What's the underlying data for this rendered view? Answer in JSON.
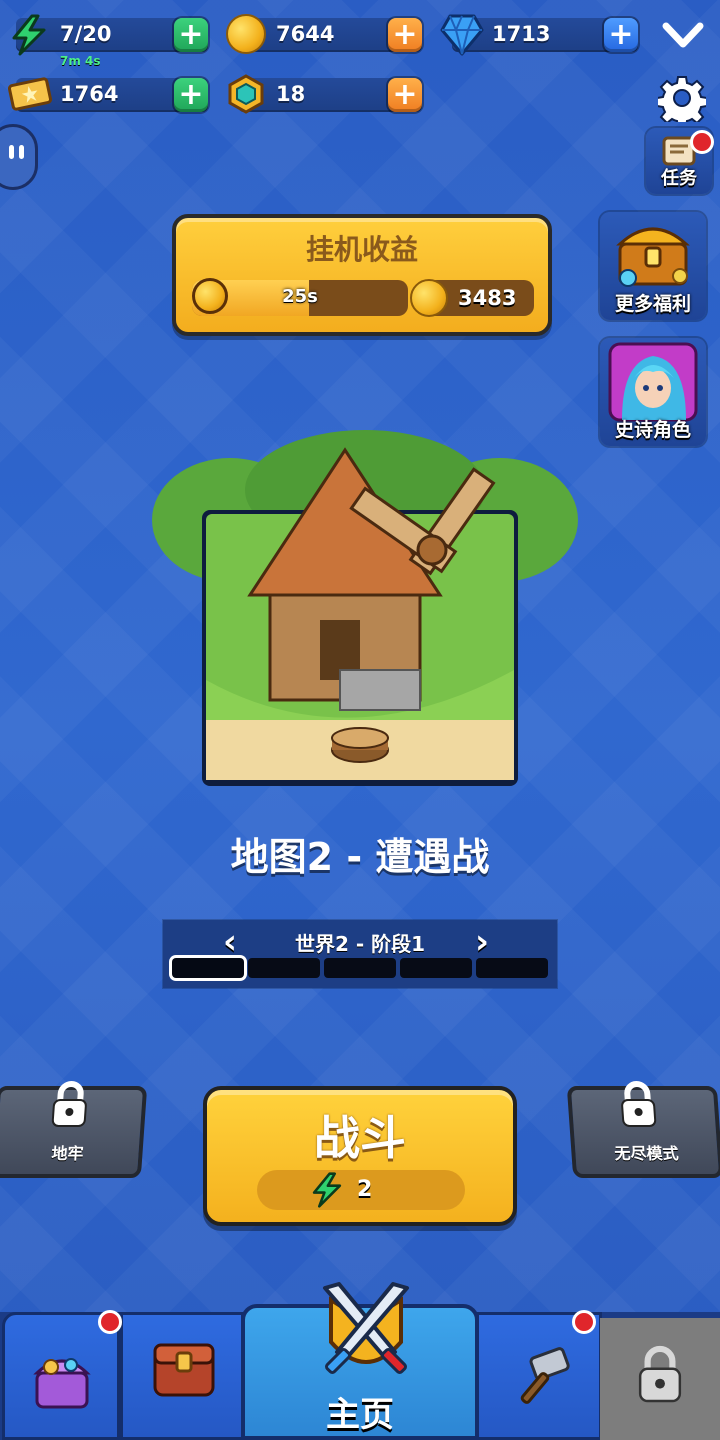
{
  "resources": {
    "energy": {
      "value": "7/20",
      "timer": "7m 4s",
      "icon": "lightning-icon",
      "color": "#2fd16e"
    },
    "gold": {
      "value": "7644",
      "icon": "gold-coin-icon"
    },
    "gems": {
      "value": "1713",
      "icon": "blue-gem-icon"
    },
    "tickets": {
      "value": "1764",
      "icon": "ticket-icon"
    },
    "tokens": {
      "value": "18",
      "icon": "teal-token-icon"
    }
  },
  "side_buttons": {
    "tasks": {
      "label": "任务",
      "icon": "scroll-icon"
    },
    "more_benefits": {
      "label": "更多福利",
      "icon": "treasure-chest-icon"
    },
    "epic_hero": {
      "label": "史诗角色",
      "icon": "elf-hero-portrait-icon"
    }
  },
  "idle_income": {
    "title": "挂机收益",
    "timer": "25s",
    "progress": 0.54,
    "amount": "3483"
  },
  "map": {
    "title": "地图2  - 遭遇战",
    "stage_label": "世界2  - 阶段1",
    "segments": [
      true,
      false,
      false,
      false,
      false
    ]
  },
  "modes": {
    "dungeon": {
      "label": "地牢",
      "locked": true
    },
    "endless": {
      "label": "无尽模式",
      "locked": true
    }
  },
  "battle": {
    "label": "战斗",
    "cost": "2"
  },
  "nav": {
    "home_label": "主页",
    "tabs": [
      "shop",
      "inventory",
      "home",
      "forge",
      "locked"
    ]
  },
  "colors": {
    "background": "#2f63c8",
    "accent_yellow": "#f4b11e",
    "plus_green": "#1fa558",
    "plus_orange": "#ef7d21",
    "plus_blue": "#2567e0",
    "notify_red": "#e0262b"
  }
}
